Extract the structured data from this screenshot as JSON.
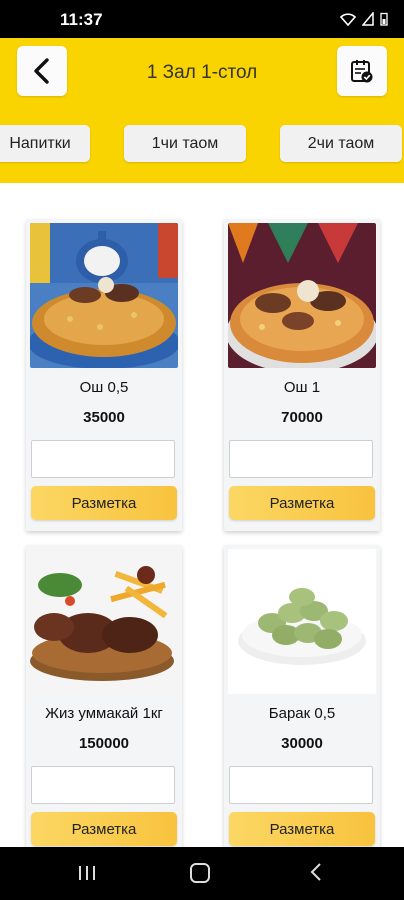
{
  "status": {
    "time": "11:37"
  },
  "header": {
    "title": "1 Зал 1-стол"
  },
  "categories": [
    {
      "label": "Напитки"
    },
    {
      "label": "1чи таом"
    },
    {
      "label": "2чи таом"
    }
  ],
  "products": [
    {
      "name": "Ош 0,5",
      "price": "35000",
      "button": "Разметка",
      "quantity": ""
    },
    {
      "name": "Ош 1",
      "price": "70000",
      "button": "Разметка",
      "quantity": ""
    },
    {
      "name": "Жиз уммакай 1кг",
      "price": "150000",
      "button": "Разметка",
      "quantity": ""
    },
    {
      "name": "Барак 0,5",
      "price": "30000",
      "button": "Разметка",
      "quantity": ""
    }
  ],
  "colors": {
    "header": "#fad400",
    "button": "#f8c33e"
  }
}
